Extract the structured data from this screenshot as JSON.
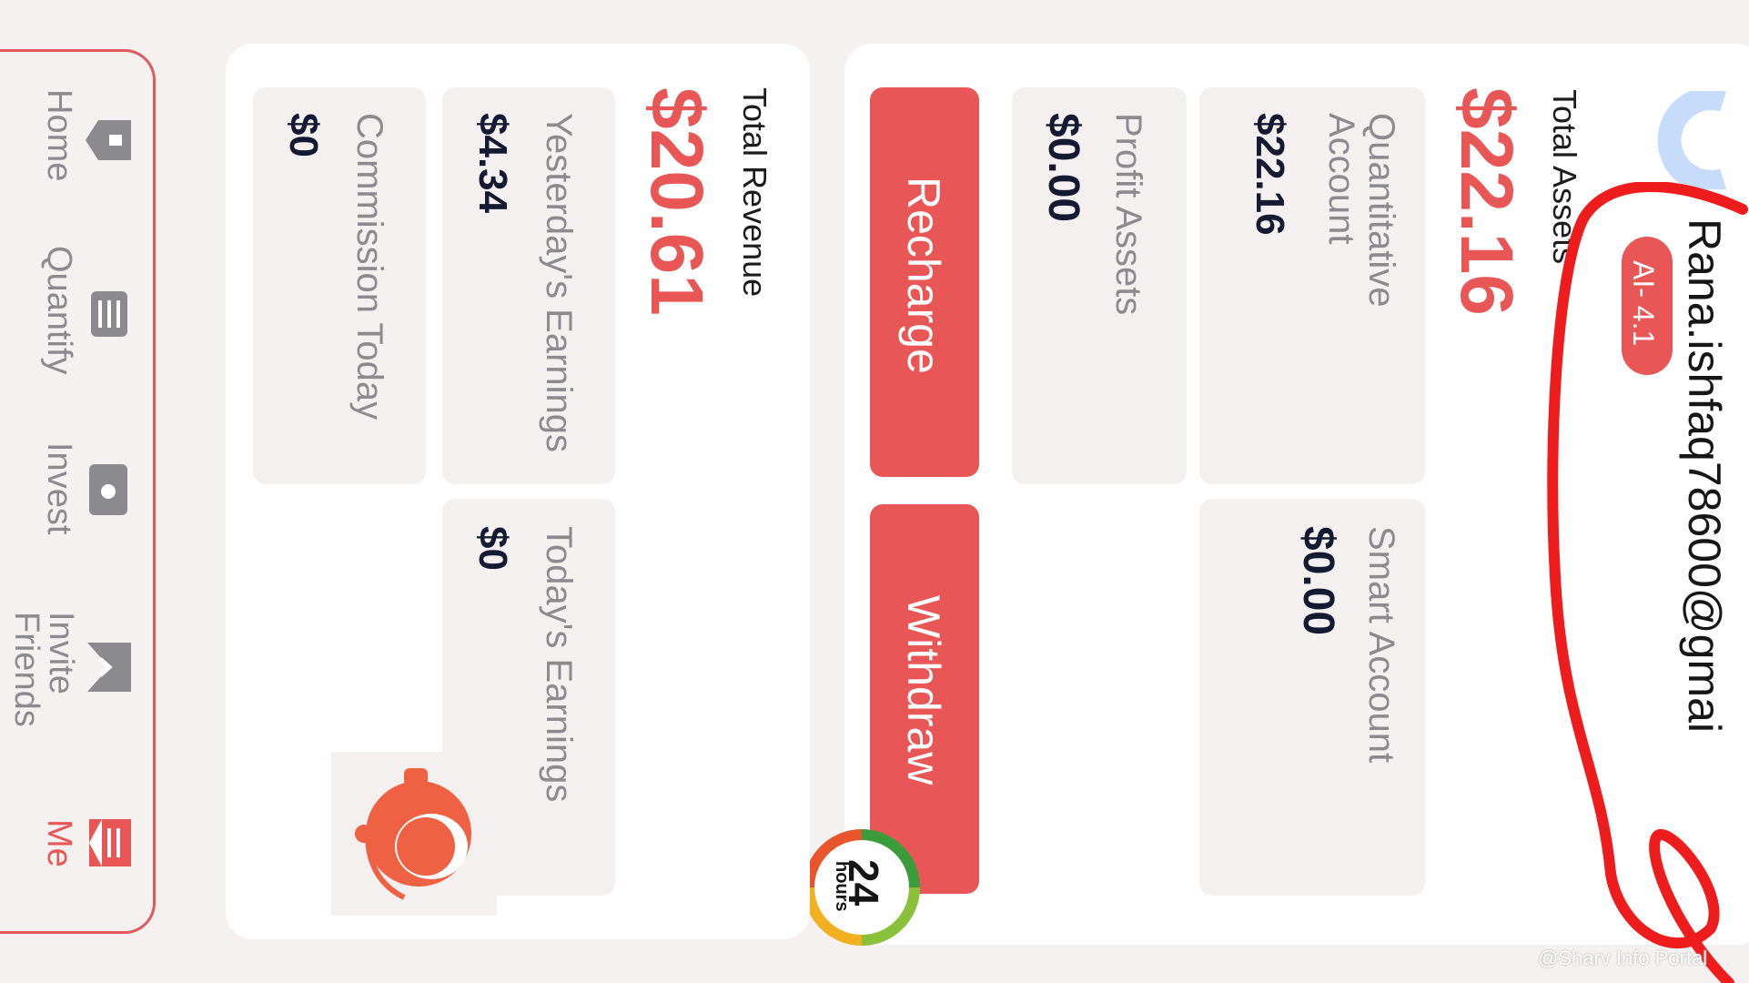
{
  "user": {
    "email": "Rana.ishfaq78600@gmai",
    "level_badge": "AI- 4.1"
  },
  "assets": {
    "total_label": "Total Assets",
    "total_value": "$22.16",
    "quantitative": {
      "label": "Quantitative Account",
      "value": "$22.16"
    },
    "smart": {
      "label": "Smart Account",
      "value": "$0.00"
    },
    "profit": {
      "label": "Profit Assets",
      "value": "$0.00"
    }
  },
  "actions": {
    "recharge_label": "Recharge",
    "withdraw_label": "Withdraw"
  },
  "revenue": {
    "total_label": "Total Revenue",
    "total_value": "$20.61",
    "yesterday": {
      "label": "Yesterday's Earnings",
      "value": "$4.34"
    },
    "today": {
      "label": "Today's Earnings",
      "value": "$0"
    },
    "commission": {
      "label": "Commission Today",
      "value": "$0"
    }
  },
  "badge_24": {
    "number": "24",
    "unit": "hours"
  },
  "nav": [
    {
      "label": "Home",
      "icon": "home-icon"
    },
    {
      "label": "Quantify",
      "icon": "quantify-icon"
    },
    {
      "label": "Invest",
      "icon": "invest-icon"
    },
    {
      "label": "Invite Friends",
      "icon": "invite-icon"
    },
    {
      "label": "Me",
      "icon": "me-icon"
    }
  ],
  "watermark": "@Sharv Info Portal",
  "colors": {
    "accent": "#e85656",
    "background": "#f6f1f1",
    "value_text": "#151a33",
    "label_text": "#8a8a8f"
  }
}
